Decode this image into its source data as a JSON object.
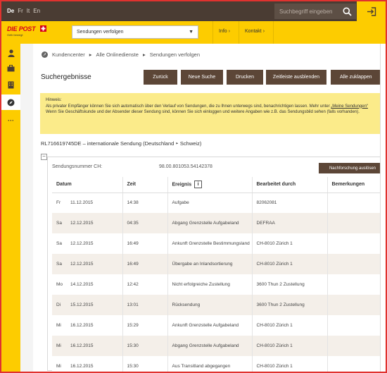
{
  "topbar": {
    "languages": [
      {
        "code": "De",
        "active": true
      },
      {
        "code": "Fr",
        "active": false
      },
      {
        "code": "It",
        "active": false
      },
      {
        "code": "En",
        "active": false
      }
    ],
    "search_placeholder": "Suchbegriff eingeben",
    "search_icon": "search-icon",
    "login_icon": "login-icon"
  },
  "header": {
    "logo_text": "DIE POST",
    "logo_tagline": "Gelb bewegt",
    "service_select": "Sendungen verfolgen",
    "nav": [
      "Info",
      "Kontakt"
    ]
  },
  "sidebar": {
    "icons": [
      "person-icon",
      "briefcase-icon",
      "building-icon",
      "compass-icon",
      "more-icon"
    ],
    "active_index": 3
  },
  "breadcrumb": [
    "Kundencenter",
    "Alle Onlinedienste",
    "Sendungen verfolgen"
  ],
  "page_title": "Suchergebnisse",
  "buttons": [
    "Zurück",
    "Neue Suche",
    "Drucken",
    "Zeitleiste ausblenden",
    "Alle zuklappen"
  ],
  "hint": {
    "title": "Hinweis:",
    "text1": "Als privater Empfänger können Sie sich automatisch über den Verlauf von Sendungen, die zu Ihnen unterwegs sind, benachrichtigen lassen. Mehr unter ",
    "link": "„Meine Sendungen“",
    "text2": "Wenn Sie Geschäftskunde und der Absender dieser Sendung sind, können Sie sich einloggen und weitere Angaben wie z.B. das Sendungsbild sehen (falls vorhanden)."
  },
  "shipment": {
    "title": "RL716619745DE – internationale Sendung (Deutschland ‣ Schweiz)",
    "number_label": "Sendungsnummer CH:",
    "number_value": "98.00.801053.54142378",
    "inquiry_button": "Nachforschung auslösen"
  },
  "table": {
    "headers": [
      "Datum",
      "Zeit",
      "Ereignis",
      "Bearbeitet durch",
      "Bemerkungen"
    ],
    "rows": [
      {
        "day": "Fr",
        "date": "11.12.2015",
        "time": "14:38",
        "event": "Aufgabe",
        "by": "82062081",
        "note": ""
      },
      {
        "day": "Sa",
        "date": "12.12.2015",
        "time": "04:35",
        "event": "Abgang Grenzstelle Aufgabeland",
        "by": "DEFRAA",
        "note": ""
      },
      {
        "day": "Sa",
        "date": "12.12.2015",
        "time": "16:49",
        "event": "Ankunft Grenzstelle Bestimmungsland",
        "by": "CH-8010 Zürich 1",
        "note": ""
      },
      {
        "day": "Sa",
        "date": "12.12.2015",
        "time": "16:49",
        "event": "Übergabe an Inlandsortierung",
        "by": "CH-8010 Zürich 1",
        "note": ""
      },
      {
        "day": "Mo",
        "date": "14.12.2015",
        "time": "12:42",
        "event": "Nicht erfolgreiche Zustellung",
        "by": "3600 Thun 2 Zustellung",
        "note": ""
      },
      {
        "day": "Di",
        "date": "15.12.2015",
        "time": "13:01",
        "event": "Rücksendung",
        "by": "3600 Thun 2 Zustellung",
        "note": ""
      },
      {
        "day": "Mi",
        "date": "16.12.2015",
        "time": "15:29",
        "event": "Ankunft Grenzstelle Aufgabeland",
        "by": "CH-8010 Zürich 1",
        "note": ""
      },
      {
        "day": "Mi",
        "date": "16.12.2015",
        "time": "15:30",
        "event": "Abgang Grenzstelle Aufgabeland",
        "by": "CH-8010 Zürich 1",
        "note": ""
      },
      {
        "day": "Mi",
        "date": "16.12.2015",
        "time": "15:30",
        "event": "Aus Transitland abgegangen",
        "by": "CH-8010 Zürich 1",
        "note": ""
      }
    ]
  }
}
